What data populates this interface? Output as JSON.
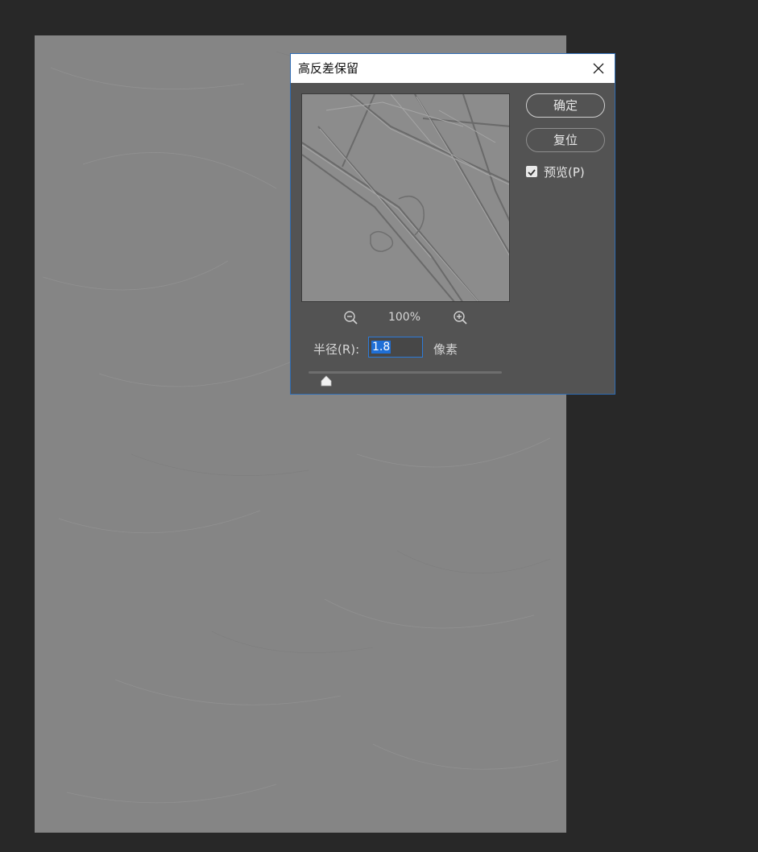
{
  "dialog": {
    "title": "高反差保留",
    "buttons": {
      "ok_label": "确定",
      "reset_label": "复位"
    },
    "preview_checkbox": {
      "label": "预览(P)",
      "checked": true
    },
    "zoom": {
      "level": "100%",
      "zoom_out_icon": "zoom-out-icon",
      "zoom_in_icon": "zoom-in-icon"
    },
    "radius": {
      "label": "半径(R):",
      "value": "1.8",
      "unit": "像素",
      "slider_fraction": 0.09
    },
    "close_icon": "close-icon"
  },
  "colors": {
    "workspace_bg": "#282828",
    "document_bg": "#858585",
    "dialog_bg": "#535353",
    "dialog_border": "#2f6cb3",
    "selection": "#1f6fd6"
  }
}
